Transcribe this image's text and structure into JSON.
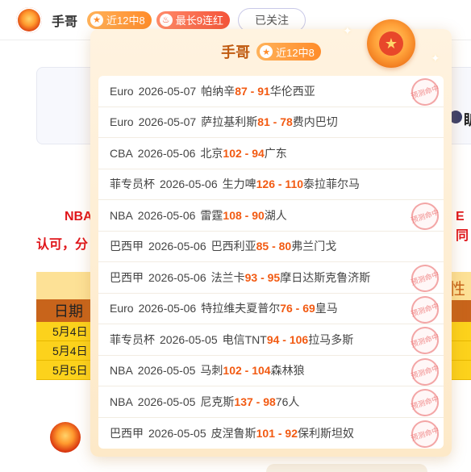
{
  "header": {
    "username": "手哥",
    "recent_badge": "近12中8",
    "streak_badge": "最长9连红",
    "follow_label": "已关注"
  },
  "background": {
    "right_text": "盺",
    "red_line1": "NBA",
    "red_line2": "认可，分",
    "red_right": "E同",
    "table_header": "日期",
    "table_rows": [
      "5月4日",
      "5月4日",
      "5月5日"
    ],
    "table_right_mark": "性"
  },
  "popup": {
    "name": "手哥",
    "badge": "近12中8",
    "stamp_text": "预测命中",
    "colors": {
      "accent": "#f25a12",
      "brand": "#c05a10",
      "stamp": "#f08a8a"
    },
    "items": [
      {
        "league": "Euro",
        "date": "2026-05-07",
        "home": "帕纳辛",
        "score": "87 - 91",
        "away": "华伦西亚",
        "hit": true
      },
      {
        "league": "Euro",
        "date": "2026-05-07",
        "home": "萨拉基利斯",
        "score": "81 - 78",
        "away": "费内巴切",
        "hit": false
      },
      {
        "league": "CBA",
        "date": "2026-05-06",
        "home": "北京",
        "score": "102 - 94",
        "away": "广东",
        "hit": false
      },
      {
        "league": "菲专员杯",
        "date": "2026-05-06",
        "home": "生力啤",
        "score": "126 - 110",
        "away": "泰拉菲尔马",
        "hit": false
      },
      {
        "league": "NBA",
        "date": "2026-05-06",
        "home": "雷霆",
        "score": "108 - 90",
        "away": "湖人",
        "hit": true
      },
      {
        "league": "巴西甲",
        "date": "2026-05-06",
        "home": "巴西利亚",
        "score": "85 - 80",
        "away": "弗兰门戈",
        "hit": false
      },
      {
        "league": "巴西甲",
        "date": "2026-05-06",
        "home": "法兰卡",
        "score": "93 - 95",
        "away": "摩日达斯克鲁济斯",
        "hit": true
      },
      {
        "league": "Euro",
        "date": "2026-05-06",
        "home": "特拉维夫夏普尔",
        "score": "76 - 69",
        "away": "皇马",
        "hit": true
      },
      {
        "league": "菲专员杯",
        "date": "2026-05-05",
        "home": "电信TNT",
        "score": "94 - 106",
        "away": "拉马多斯",
        "hit": true
      },
      {
        "league": "NBA",
        "date": "2026-05-05",
        "home": "马刺",
        "score": "102 - 104",
        "away": "森林狼",
        "hit": true
      },
      {
        "league": "NBA",
        "date": "2026-05-05",
        "home": "尼克斯",
        "score": "137 - 98",
        "away": "76人",
        "hit": true
      },
      {
        "league": "巴西甲",
        "date": "2026-05-05",
        "home": "皮涅鲁斯",
        "score": "101 - 92",
        "away": "保利斯坦奴",
        "hit": true
      }
    ]
  }
}
